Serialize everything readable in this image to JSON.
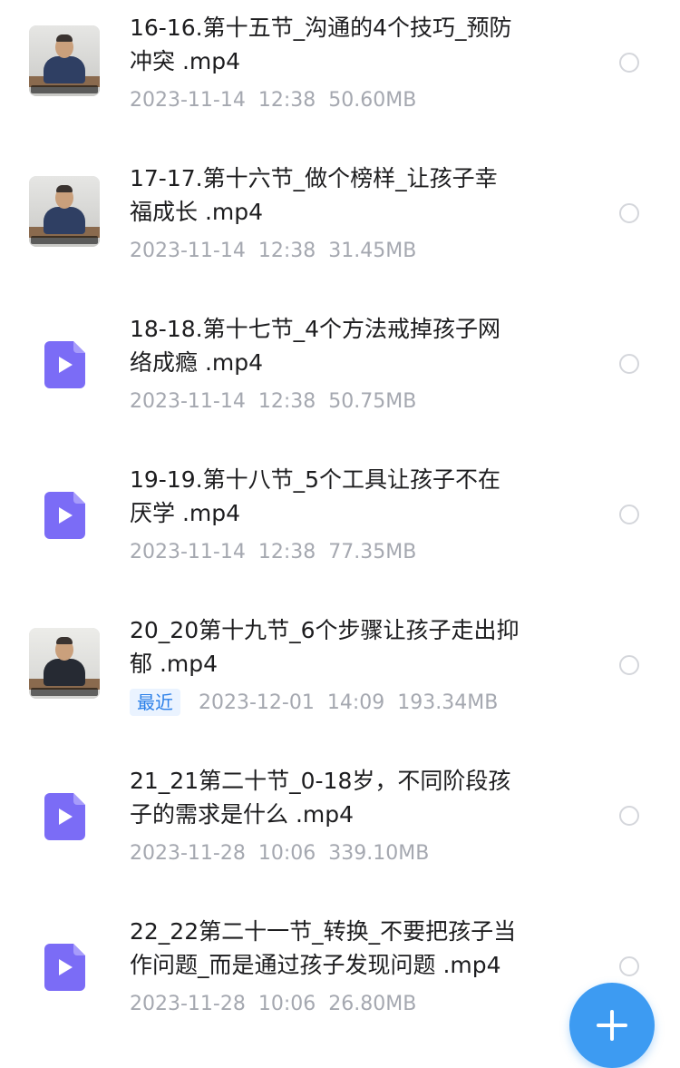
{
  "files": [
    {
      "name": "16-16.第十五节_沟通的4个技巧_预防冲突 .mp4",
      "date": "2023-11-14",
      "time": "12:38",
      "size": "50.60MB",
      "thumb": "photo",
      "badge": ""
    },
    {
      "name": "17-17.第十六节_做个榜样_让孩子幸福成长 .mp4",
      "date": "2023-11-14",
      "time": "12:38",
      "size": "31.45MB",
      "thumb": "photo",
      "badge": ""
    },
    {
      "name": "18-18.第十七节_4个方法戒掉孩子网络成瘾 .mp4",
      "date": "2023-11-14",
      "time": "12:38",
      "size": "50.75MB",
      "thumb": "video-icon",
      "badge": ""
    },
    {
      "name": "19-19.第十八节_5个工具让孩子不在厌学 .mp4",
      "date": "2023-11-14",
      "time": "12:38",
      "size": "77.35MB",
      "thumb": "video-icon",
      "badge": ""
    },
    {
      "name": "20_20第十九节_6个步骤让孩子走出抑郁 .mp4",
      "date": "2023-12-01",
      "time": "14:09",
      "size": "193.34MB",
      "thumb": "photo-dark",
      "badge": "最近"
    },
    {
      "name": "21_21第二十节_0-18岁，不同阶段孩子的需求是什么 .mp4",
      "date": "2023-11-28",
      "time": "10:06",
      "size": "339.10MB",
      "thumb": "video-icon",
      "badge": ""
    },
    {
      "name": "22_22第二十一节_转换_不要把孩子当作问题_而是通过孩子发现问题  .mp4",
      "date": "2023-11-28",
      "time": "10:06",
      "size": "26.80MB",
      "thumb": "video-icon",
      "badge": ""
    }
  ],
  "fab": {
    "icon": "plus-icon"
  },
  "colors": {
    "accent": "#3d9bf2",
    "play_icon": "#7b6cf6",
    "meta_text": "#a5a8b0",
    "badge_text": "#2a7fe8"
  }
}
